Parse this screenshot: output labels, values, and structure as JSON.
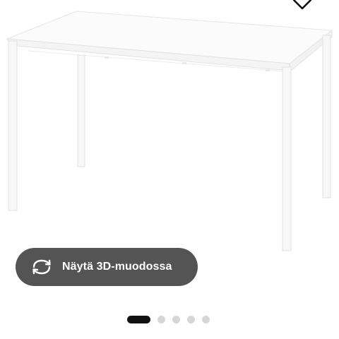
{
  "product": {
    "image_alt": "white table"
  },
  "favorite": {
    "icon": "heart-icon"
  },
  "view3d": {
    "icon": "rotate-icon",
    "label": "Näytä 3D-muodossa"
  },
  "carousel": {
    "total": 5,
    "active_index": 0
  },
  "colors": {
    "button_bg": "#545454",
    "dot_active": "#111111",
    "dot_inactive": "#d6d6d6"
  }
}
